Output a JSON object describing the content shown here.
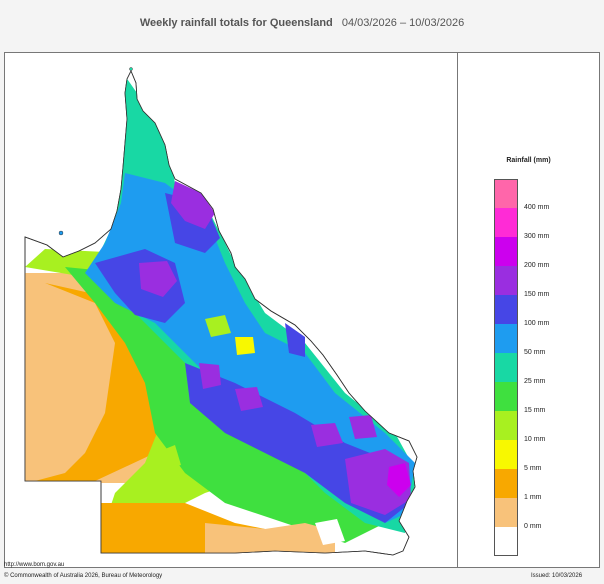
{
  "header": {
    "title": "Weekly rainfall totals for Queensland",
    "dates": "04/03/2026 – 10/03/2026"
  },
  "legend": {
    "title": "Rainfall (mm)",
    "classes": [
      {
        "label": "",
        "color": "#ff66aa"
      },
      {
        "label": "400 mm",
        "color": "#ff2bd6"
      },
      {
        "label": "300 mm",
        "color": "#cc00ee"
      },
      {
        "label": "200 mm",
        "color": "#9a2ee0"
      },
      {
        "label": "150 mm",
        "color": "#4646e6"
      },
      {
        "label": "100 mm",
        "color": "#1e9cf0"
      },
      {
        "label": "50 mm",
        "color": "#18d8a4"
      },
      {
        "label": "25 mm",
        "color": "#3fe03f"
      },
      {
        "label": "15 mm",
        "color": "#a8f020"
      },
      {
        "label": "10 mm",
        "color": "#f8f800"
      },
      {
        "label": "5 mm",
        "color": "#f8a800"
      },
      {
        "label": "1 mm",
        "color": "#f8c27a"
      },
      {
        "label": "0 mm",
        "color": "#ffffff"
      }
    ]
  },
  "footer": {
    "url": "http://www.bom.gov.au",
    "copyright": "© Commonwealth of Australia 2026, Bureau of Meteorology",
    "issued": "Issued: 10/03/2026"
  }
}
